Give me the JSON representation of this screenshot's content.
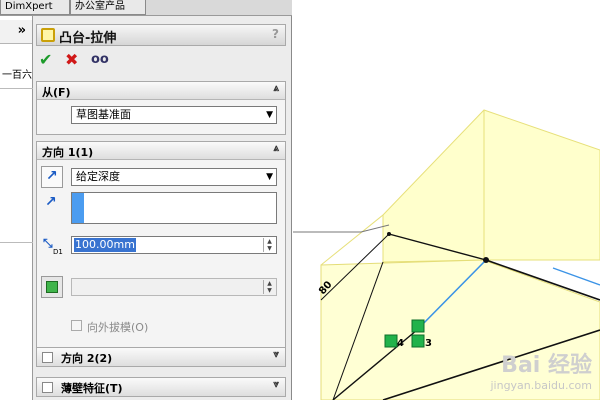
{
  "top_tabs": [
    "DimXpert",
    "办公室产品"
  ],
  "left_panel": {
    "expand_glyph": "»",
    "truncated_label": "一百六"
  },
  "feature": {
    "title": "凸台-拉伸",
    "help_glyph": "?",
    "ok_glyph": "✔",
    "cancel_glyph": "✖",
    "preview_glyph": "oo"
  },
  "from_group": {
    "title": "从(F)",
    "collapse_glyph": "⩓",
    "start_condition": "草图基准面"
  },
  "direction1": {
    "title": "方向 1(1)",
    "collapse_glyph": "⩓",
    "end_condition": "给定深度",
    "depth_value": "100.00mm",
    "depth_label": "D1",
    "draft_outward_label": "向外拔模(O)"
  },
  "direction2": {
    "title": "方向 2(2)",
    "expand_glyph": "⩔"
  },
  "thin_feature": {
    "title": "薄壁特征(T)",
    "expand_glyph": "⩔"
  },
  "viewport": {
    "relations": [
      "4",
      "3"
    ],
    "dim_label": "80",
    "watermark_main": "Bai 经验",
    "watermark_url": "jingyan.baidu.com"
  },
  "colors": {
    "accent_blue": "#3873d0",
    "solid_yellow": "#ffffb0",
    "relation_green": "#21b24b"
  }
}
